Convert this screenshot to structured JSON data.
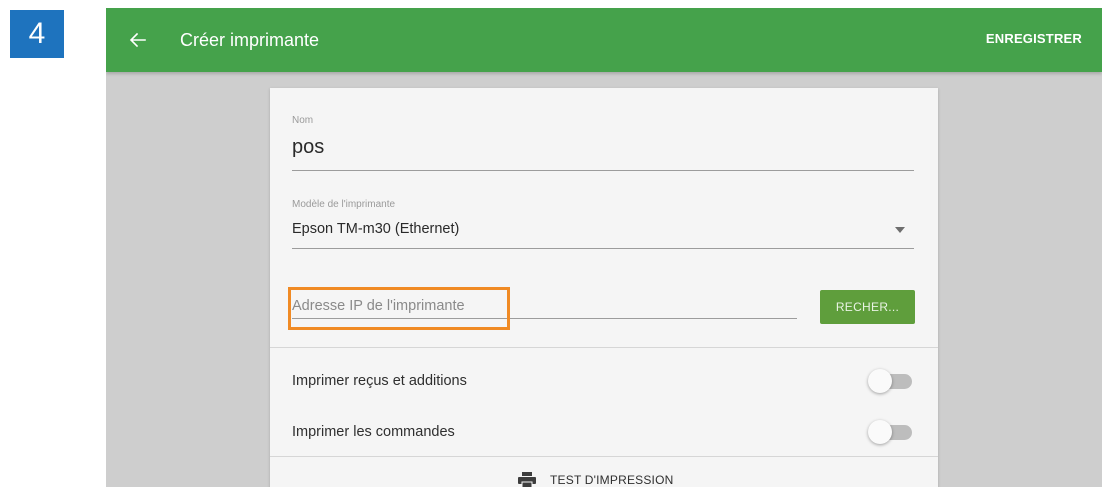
{
  "step_badge": "4",
  "appbar": {
    "title": "Créer imprimante",
    "save_label": "ENREGISTRER"
  },
  "form": {
    "name": {
      "label": "Nom",
      "value": "pos"
    },
    "model": {
      "label": "Modèle de l'imprimante",
      "value": "Epson TM-m30 (Ethernet)"
    },
    "ip": {
      "placeholder": "Adresse IP de l'imprimante",
      "value": ""
    },
    "search_label": "RECHER...",
    "toggles": [
      {
        "label": "Imprimer reçus et additions",
        "on": false
      },
      {
        "label": "Imprimer les commandes",
        "on": false
      }
    ],
    "test_print_label": "TEST D'IMPRESSION"
  },
  "colors": {
    "appbar": "#45a24b",
    "search_button": "#5f9e3c",
    "highlight": "#f08a24",
    "badge": "#1e73be"
  },
  "icons": {
    "back": "back-arrow-icon",
    "dropdown": "dropdown-triangle-icon",
    "printer": "printer-icon"
  }
}
